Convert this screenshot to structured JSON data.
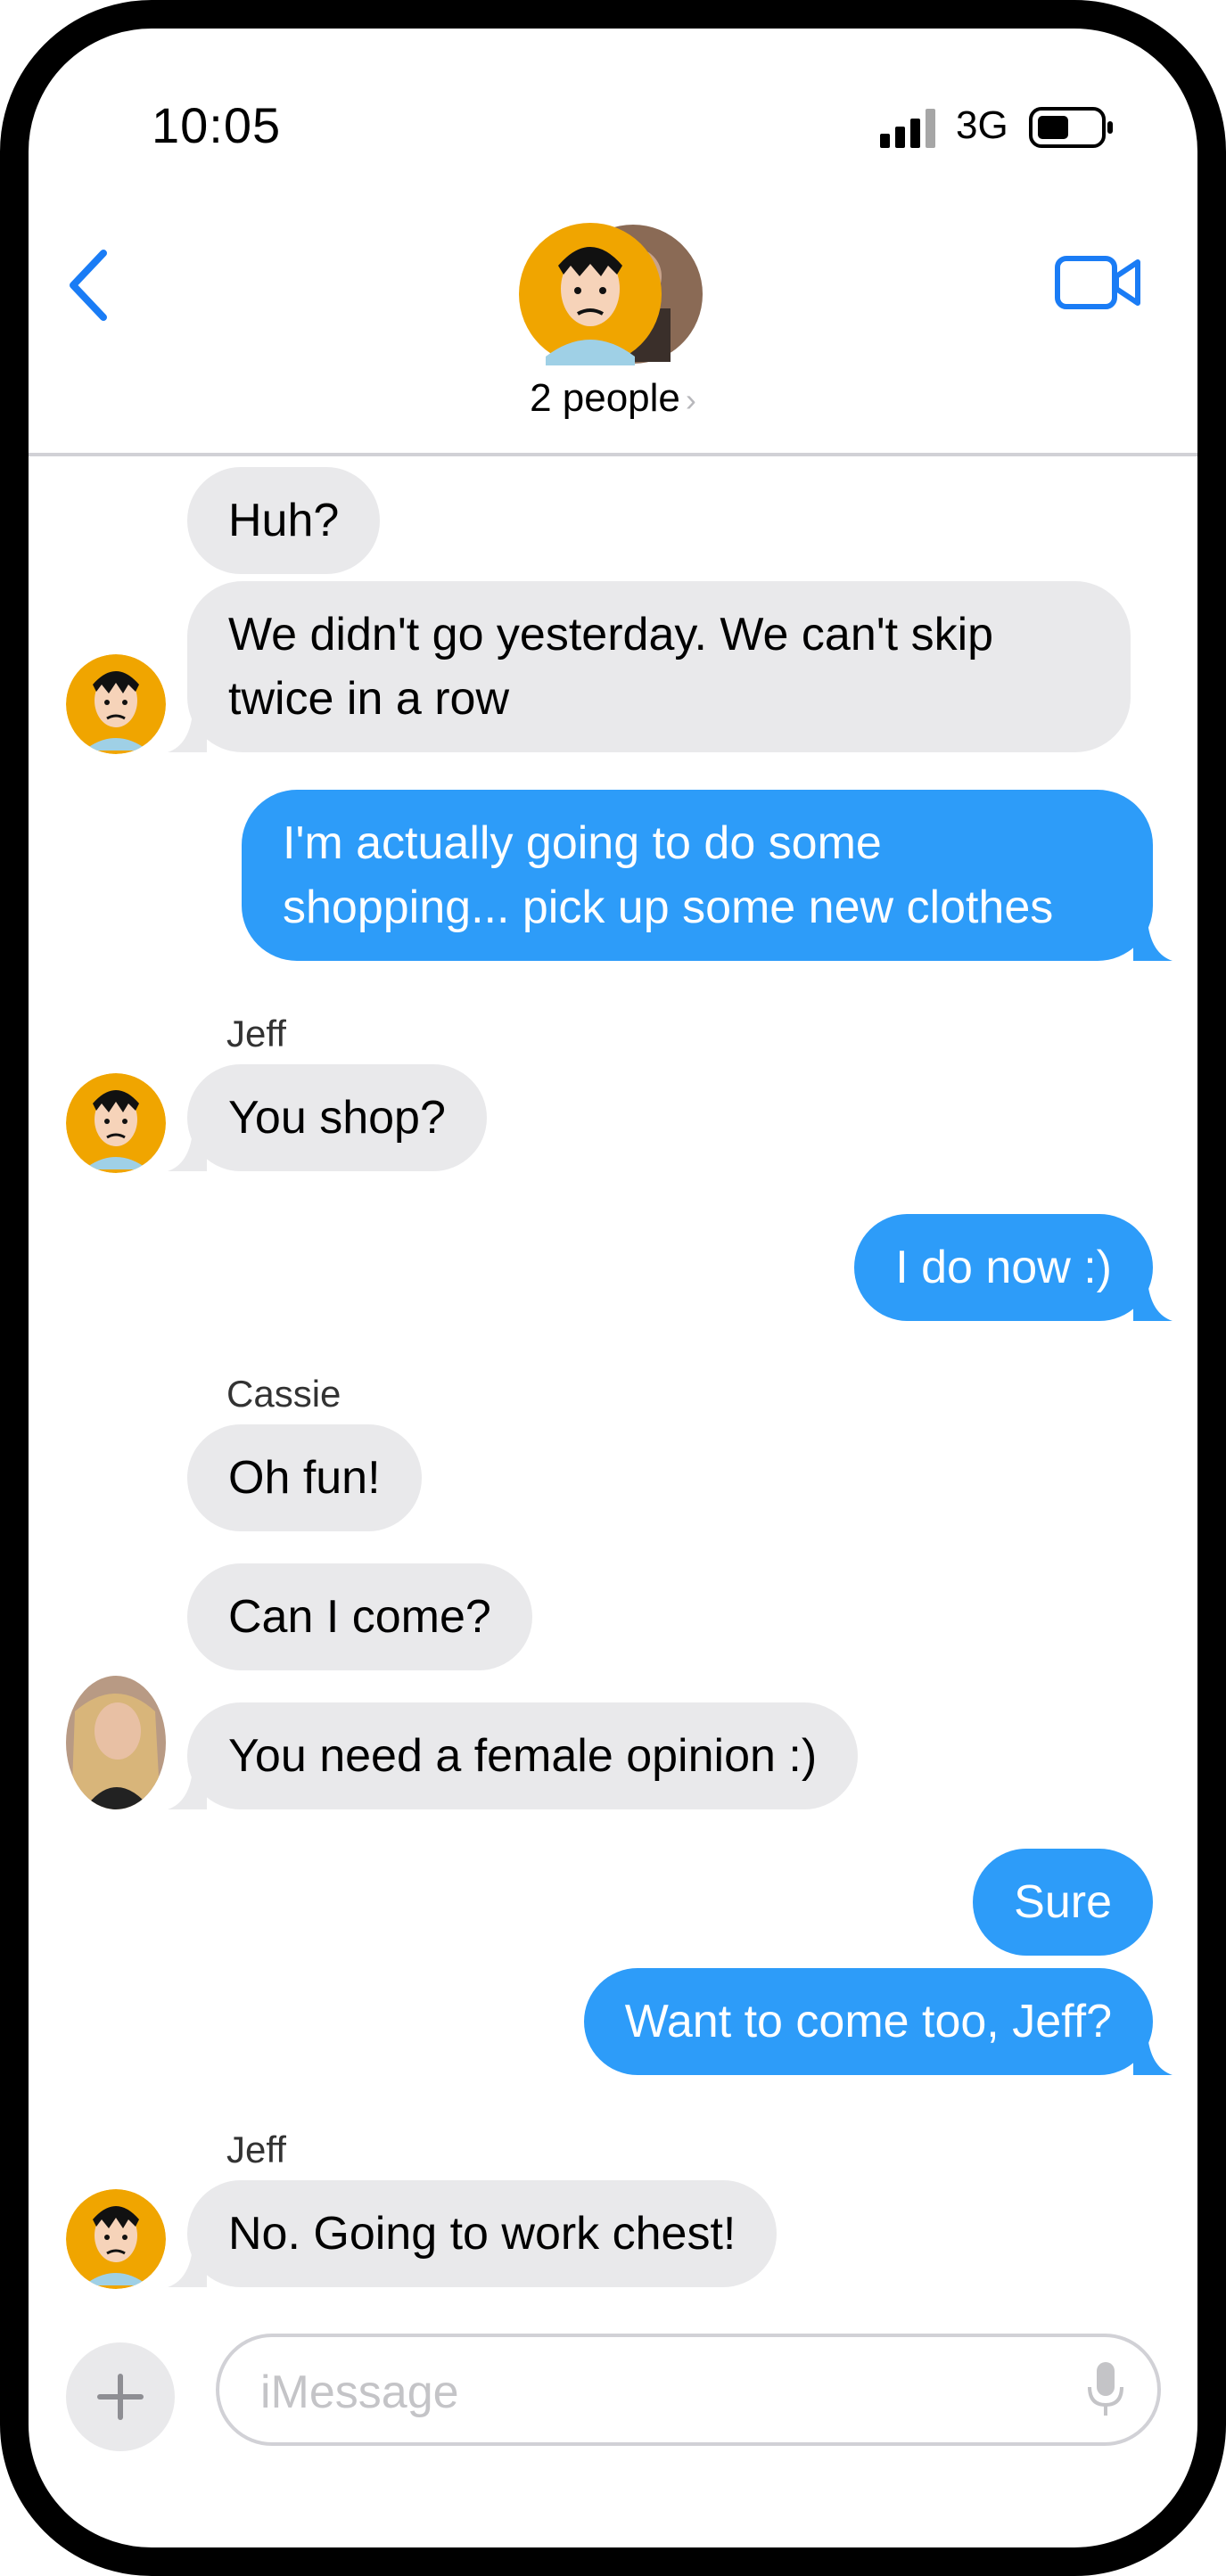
{
  "status_bar": {
    "time": "10:05",
    "network": "3G"
  },
  "header": {
    "people_label": "2 people",
    "chevron": "›"
  },
  "messages": [
    {
      "text": "Huh?"
    },
    {
      "lines": [
        "We didn't go yesterday.  We can't skip",
        "twice in a row"
      ]
    },
    {
      "lines": [
        "I'm actually going to do some",
        "shopping... pick up some new clothes"
      ]
    },
    {
      "sender": "Jeff",
      "text": "You shop?"
    },
    {
      "text": "I do now :)"
    },
    {
      "sender": "Cassie",
      "text": "Oh fun!"
    },
    {
      "text": "Can I come?"
    },
    {
      "text": "You need a female opinion :)"
    },
    {
      "text": "Sure"
    },
    {
      "text": "Want to come too, Jeff?"
    },
    {
      "sender": "Jeff",
      "text": "No.  Going to work chest!"
    }
  ],
  "composer": {
    "placeholder": "iMessage",
    "plus": "+"
  },
  "icons": [
    "back-chevron-icon",
    "video-camera-icon",
    "plus-icon",
    "microphone-icon"
  ],
  "colors": {
    "accent": "#1a7cf5",
    "outgoing_bubble": "#2d9cf9",
    "incoming_bubble": "#e9e9eb"
  }
}
